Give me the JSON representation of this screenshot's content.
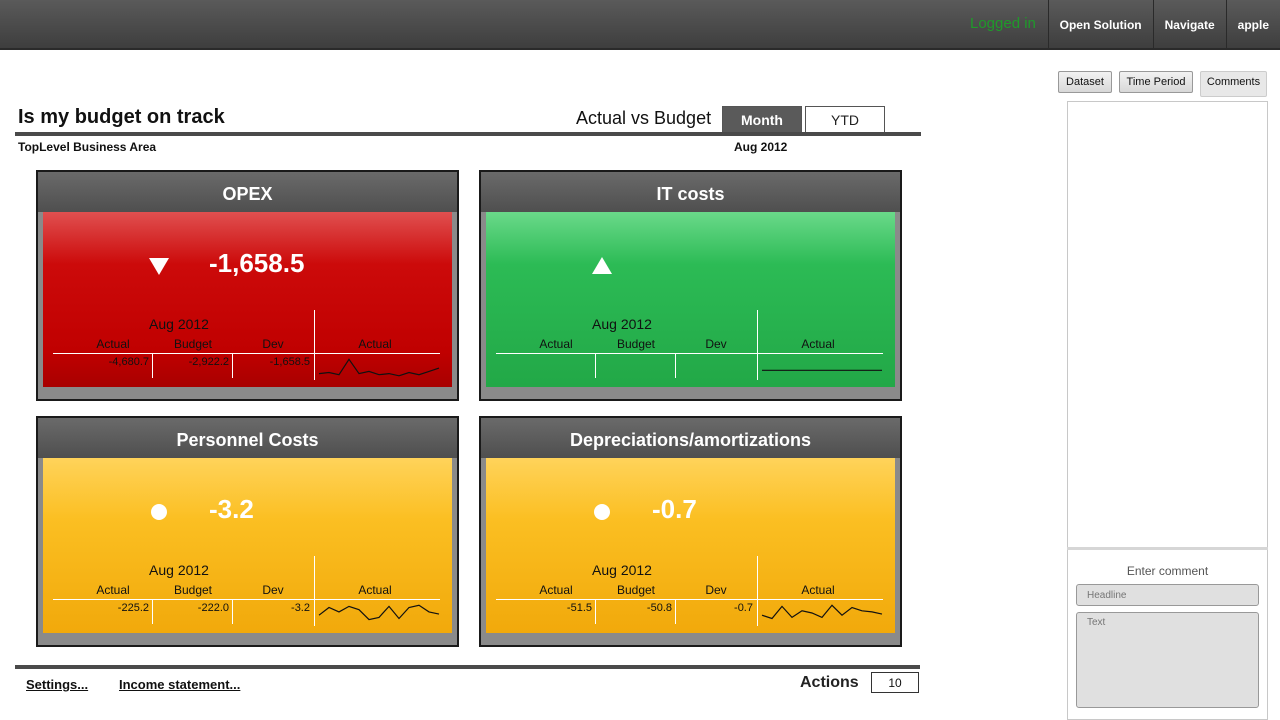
{
  "topbar": {
    "status": "Logged in",
    "nav": [
      "Open Solution",
      "Navigate",
      "apple"
    ]
  },
  "header": {
    "title": "Is my budget on track",
    "comparison": "Actual vs Budget",
    "toggle_month": "Month",
    "toggle_ytd": "YTD",
    "area": "TopLevel Business Area",
    "period": "Aug 2012"
  },
  "tiles": [
    {
      "title": "OPEX",
      "status": "red",
      "indicator": "down-triangle-icon",
      "value": "-1,658.5",
      "period": "Aug 2012",
      "labels": [
        "Actual",
        "Budget",
        "Dev",
        "Actual"
      ],
      "actual": "-4,680.7",
      "budget": "-2,922.2",
      "dev": "-1,658.5",
      "spark": [
        0.2,
        0.25,
        0.15,
        0.85,
        0.2,
        0.3,
        0.15,
        0.2,
        0.1,
        0.25,
        0.15,
        0.3,
        0.45
      ]
    },
    {
      "title": "IT costs",
      "status": "green",
      "indicator": "up-triangle-icon",
      "value": "",
      "period": "Aug 2012",
      "labels": [
        "Actual",
        "Budget",
        "Dev",
        "Actual"
      ],
      "actual": "",
      "budget": "",
      "dev": "",
      "spark": [
        0.35,
        0.35,
        0.35,
        0.35,
        0.35,
        0.35,
        0.35,
        0.35,
        0.35,
        0.35,
        0.35,
        0.35,
        0.35
      ]
    },
    {
      "title": "Personnel Costs",
      "status": "amber",
      "indicator": "circle-icon",
      "value": "-3.2",
      "period": "Aug 2012",
      "labels": [
        "Actual",
        "Budget",
        "Dev",
        "Actual"
      ],
      "actual": "-225.2",
      "budget": "-222.0",
      "dev": "-3.2",
      "spark": [
        0.4,
        0.75,
        0.55,
        0.8,
        0.65,
        0.2,
        0.3,
        0.8,
        0.25,
        0.75,
        0.85,
        0.55,
        0.45
      ]
    },
    {
      "title": "Depreciations/amortizations",
      "status": "amber",
      "indicator": "circle-icon",
      "value": "-0.7",
      "period": "Aug 2012",
      "labels": [
        "Actual",
        "Budget",
        "Dev",
        "Actual"
      ],
      "actual": "-51.5",
      "budget": "-50.8",
      "dev": "-0.7",
      "spark": [
        0.4,
        0.25,
        0.8,
        0.3,
        0.6,
        0.5,
        0.3,
        0.85,
        0.4,
        0.75,
        0.6,
        0.55,
        0.45
      ]
    }
  ],
  "footer": {
    "settings": "Settings...",
    "income": "Income statement...",
    "actions_label": "Actions",
    "actions_count": "10"
  },
  "right_panel": {
    "tabs": [
      "Dataset",
      "Time Period",
      "Comments"
    ],
    "enter_comment": "Enter comment",
    "headline_placeholder": "Headline",
    "text_placeholder": "Text"
  },
  "colors": {
    "red": "#c00000",
    "green": "#22a847",
    "amber": "#fbbf22",
    "chrome": "#4f4f4f"
  }
}
